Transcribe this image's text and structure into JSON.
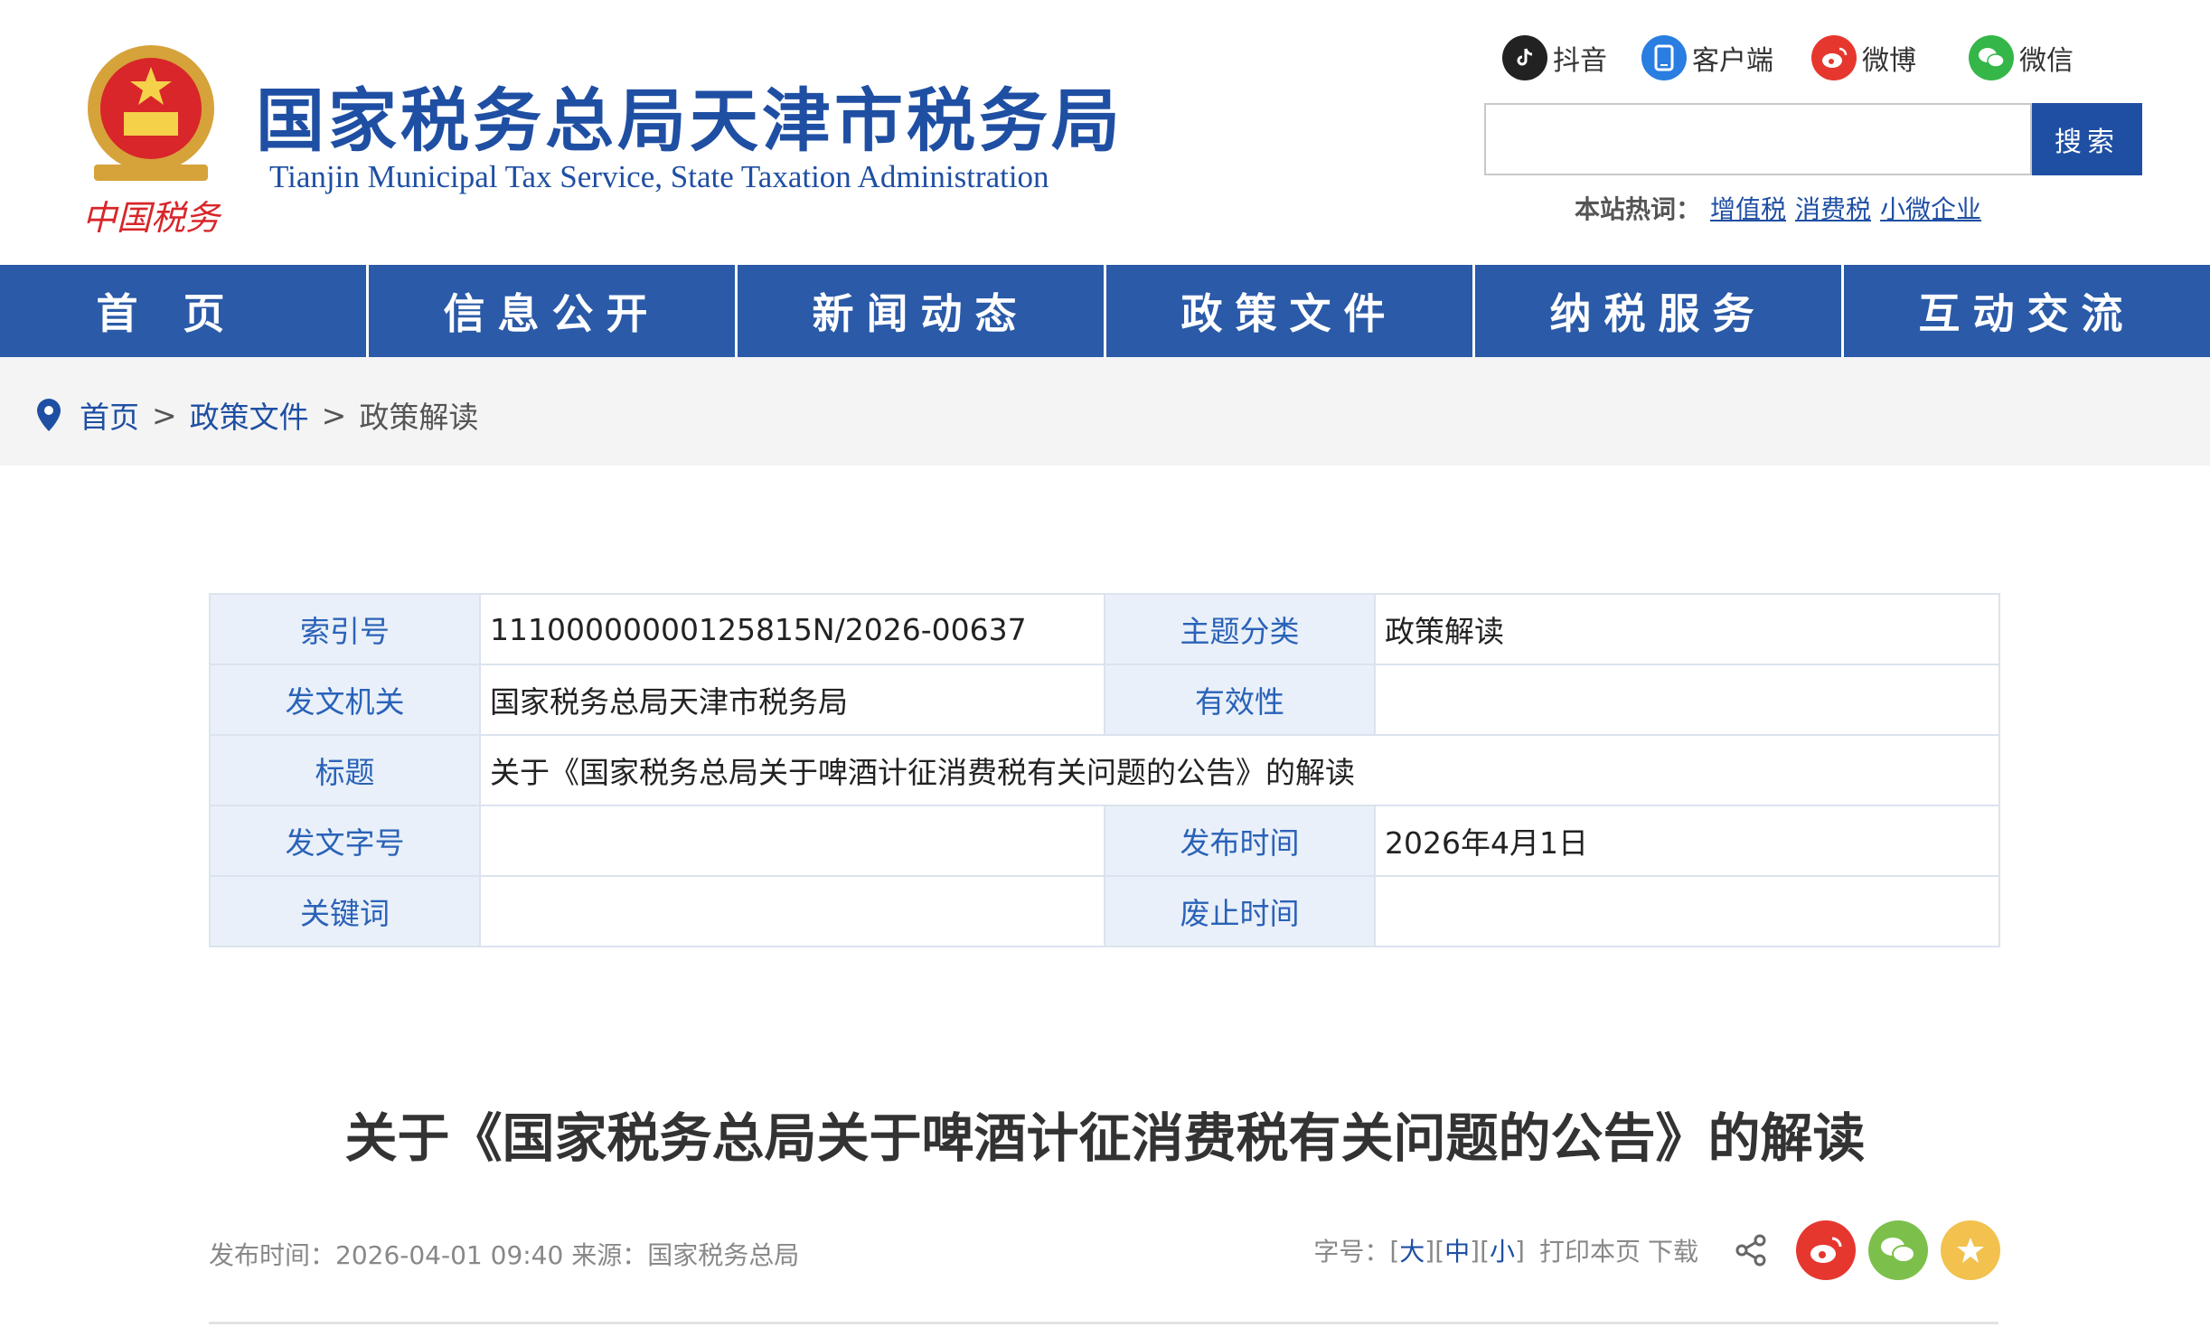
{
  "site": {
    "title": "国家税务总局天津市税务局",
    "subtitle": "Tianjin Municipal Tax Service, State Taxation Administration",
    "logo_text": "中国税务"
  },
  "social": [
    {
      "label": "抖音",
      "icon": "tiktok-icon",
      "color": "#222222"
    },
    {
      "label": "客户端",
      "icon": "mobile-app-icon",
      "color": "#2a7de1"
    },
    {
      "label": "微博",
      "icon": "weibo-icon",
      "color": "#e6372f"
    },
    {
      "label": "微信",
      "icon": "wechat-icon",
      "color": "#35b649"
    }
  ],
  "search": {
    "value": "",
    "button_label": "搜索",
    "hot_label": "本站热词：",
    "hot_words": [
      "增值税",
      "消费税",
      "小微企业"
    ]
  },
  "nav": [
    "首页",
    "信息公开",
    "新闻动态",
    "政策文件",
    "纳税服务",
    "互动交流"
  ],
  "breadcrumb": {
    "icon": "location-pin-icon",
    "items": [
      "首页",
      "政策文件",
      "政策解读"
    ],
    "separator": ">"
  },
  "info": {
    "index_label": "索引号",
    "index_value": "11100000000125815N/2026-00637",
    "topic_label": "主题分类",
    "topic_value": "政策解读",
    "issuer_label": "发文机关",
    "issuer_value": "国家税务总局天津市税务局",
    "validity_label": "有效性",
    "validity_value": "",
    "title_label": "标题",
    "title_value": "关于《国家税务总局关于啤酒计征消费税有关问题的公告》的解读",
    "docno_label": "发文字号",
    "docno_value": "",
    "pubdate_label": "发布时间",
    "pubdate_value": "2026年4月1日",
    "keywords_label": "关键词",
    "keywords_value": "",
    "expiry_label": "废止时间",
    "expiry_value": ""
  },
  "article": {
    "title": "关于《国家税务总局关于啤酒计征消费税有关问题的公告》的解读",
    "meta": "发布时间：2026-04-01 09:40  来源：国家税务总局",
    "font_label": "字号：",
    "font_large": "大",
    "font_medium": "中",
    "font_small": "小",
    "print_label": "打印本页",
    "download_label": "下载"
  },
  "colors": {
    "brand_blue": "#1f4fa3",
    "nav_blue": "#2a5aa8",
    "weibo_red": "#e6372f",
    "wechat_green": "#7cc04b",
    "favorite_gold": "#f2c14e"
  }
}
